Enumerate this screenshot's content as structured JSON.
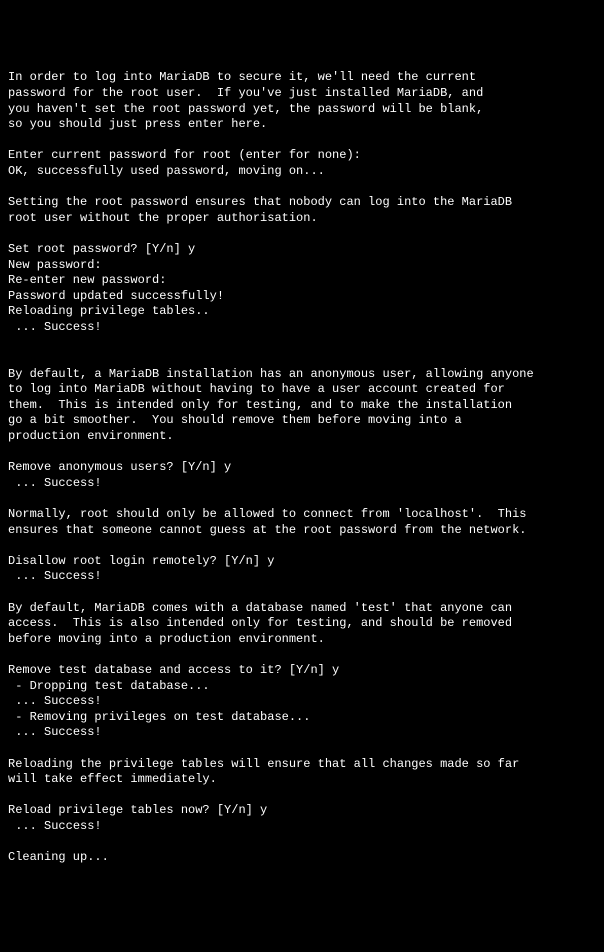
{
  "terminal": {
    "lines": [
      "In order to log into MariaDB to secure it, we'll need the current",
      "password for the root user.  If you've just installed MariaDB, and",
      "you haven't set the root password yet, the password will be blank,",
      "so you should just press enter here.",
      "",
      "Enter current password for root (enter for none):",
      "OK, successfully used password, moving on...",
      "",
      "Setting the root password ensures that nobody can log into the MariaDB",
      "root user without the proper authorisation.",
      "",
      "Set root password? [Y/n] y",
      "New password:",
      "Re-enter new password:",
      "Password updated successfully!",
      "Reloading privilege tables..",
      " ... Success!",
      "",
      "",
      "By default, a MariaDB installation has an anonymous user, allowing anyone",
      "to log into MariaDB without having to have a user account created for",
      "them.  This is intended only for testing, and to make the installation",
      "go a bit smoother.  You should remove them before moving into a",
      "production environment.",
      "",
      "Remove anonymous users? [Y/n] y",
      " ... Success!",
      "",
      "Normally, root should only be allowed to connect from 'localhost'.  This",
      "ensures that someone cannot guess at the root password from the network.",
      "",
      "Disallow root login remotely? [Y/n] y",
      " ... Success!",
      "",
      "By default, MariaDB comes with a database named 'test' that anyone can",
      "access.  This is also intended only for testing, and should be removed",
      "before moving into a production environment.",
      "",
      "Remove test database and access to it? [Y/n] y",
      " - Dropping test database...",
      " ... Success!",
      " - Removing privileges on test database...",
      " ... Success!",
      "",
      "Reloading the privilege tables will ensure that all changes made so far",
      "will take effect immediately.",
      "",
      "Reload privilege tables now? [Y/n] y",
      " ... Success!",
      "",
      "Cleaning up..."
    ]
  }
}
